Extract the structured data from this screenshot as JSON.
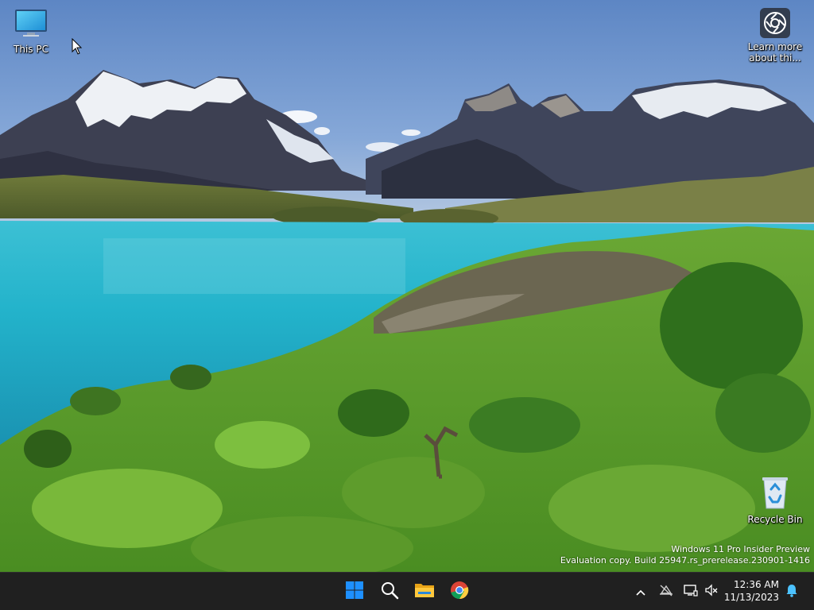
{
  "desktop": {
    "icons": {
      "this_pc": {
        "label": "This PC",
        "icon": "monitor-icon"
      },
      "learn_more": {
        "label": "Learn more about thi...",
        "icon": "camera-icon"
      },
      "recycle_bin": {
        "label": "Recycle Bin",
        "icon": "recycle-bin-icon"
      }
    },
    "watermark": {
      "line1": "Windows 11 Pro Insider Preview",
      "line2": "Evaluation copy. Build 25947.rs_prerelease.230901-1416"
    }
  },
  "taskbar": {
    "apps": [
      {
        "name": "Start",
        "icon": "windows-logo-icon"
      },
      {
        "name": "Search",
        "icon": "search-icon"
      },
      {
        "name": "File Explorer",
        "icon": "folder-icon"
      },
      {
        "name": "Google Chrome",
        "icon": "chrome-icon"
      }
    ],
    "tray": {
      "icons": [
        "chevron-up-icon",
        "network-disconnected-icon",
        "display-icon",
        "volume-muted-icon",
        "notification-bell-icon"
      ],
      "time": "12:36 AM",
      "date": "11/13/2023"
    }
  },
  "colors": {
    "taskbar_bg": "#202020",
    "accent_blue": "#0078d4",
    "bell_accent": "#4cc2ff"
  }
}
